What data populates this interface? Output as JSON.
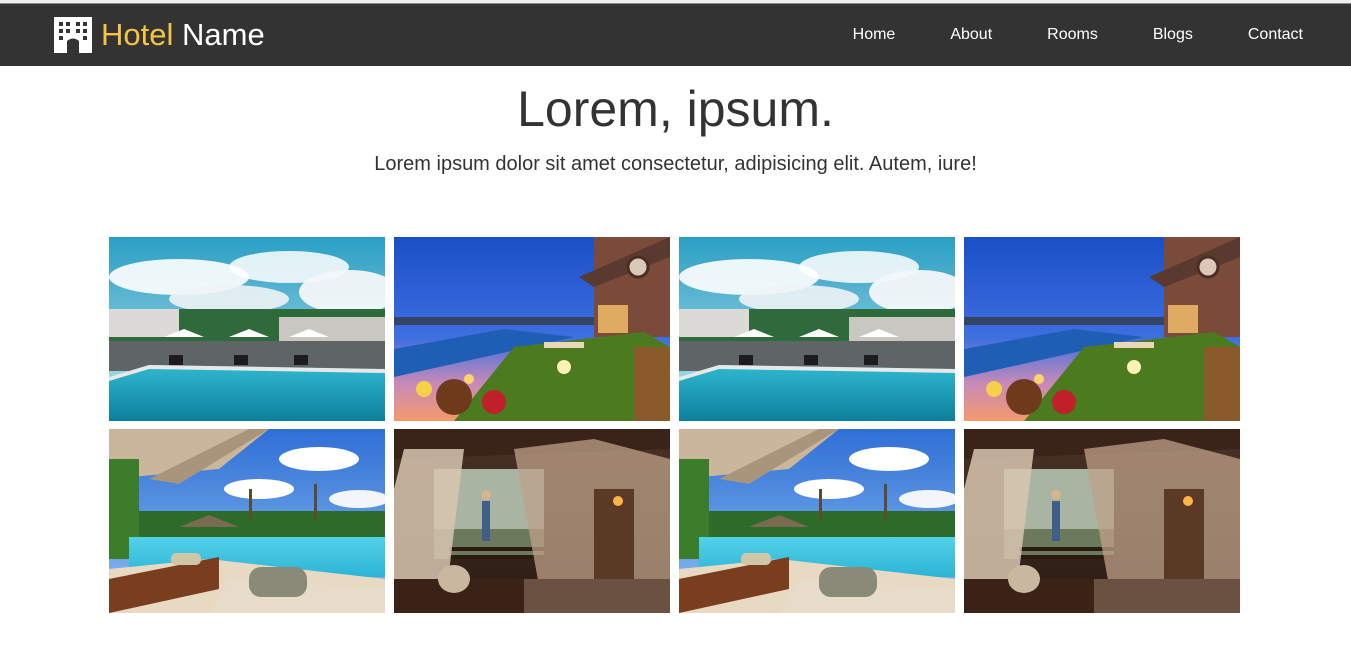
{
  "brand": {
    "icon": "hotel-building-icon",
    "word1": "Hotel",
    "word2": "Name",
    "accent_color": "#f5c542"
  },
  "nav": {
    "items": [
      {
        "label": "Home"
      },
      {
        "label": "About"
      },
      {
        "label": "Rooms"
      },
      {
        "label": "Blogs"
      },
      {
        "label": "Contact"
      }
    ],
    "background": "#333333"
  },
  "hero": {
    "title": "Lorem, ipsum.",
    "subtitle": "Lorem ipsum dolor sit amet consectetur, adipisicing elit. Autem, iure!"
  },
  "gallery": {
    "photos": [
      {
        "scene": "pool-day"
      },
      {
        "scene": "terrace-dusk"
      },
      {
        "scene": "pool-day"
      },
      {
        "scene": "terrace-dusk"
      },
      {
        "scene": "tropical-pool"
      },
      {
        "scene": "canopy-bedroom"
      },
      {
        "scene": "tropical-pool"
      },
      {
        "scene": "canopy-bedroom"
      }
    ]
  }
}
